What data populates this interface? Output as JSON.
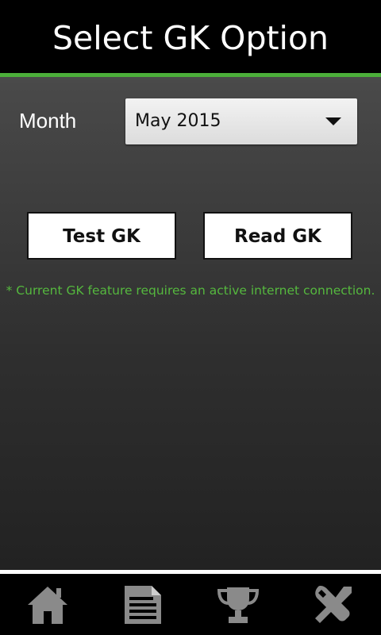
{
  "header": {
    "title": "Select GK Option"
  },
  "colors": {
    "accent": "#4caf3a",
    "note": "#55b83e"
  },
  "form": {
    "month_label": "Month",
    "month_selected": "May 2015"
  },
  "buttons": {
    "test_label": "Test GK",
    "read_label": "Read GK"
  },
  "note": "* Current GK feature requires an active internet connection.",
  "bottom_nav": [
    {
      "icon": "home-icon"
    },
    {
      "icon": "document-icon"
    },
    {
      "icon": "trophy-icon"
    },
    {
      "icon": "settings-tools-icon"
    }
  ]
}
